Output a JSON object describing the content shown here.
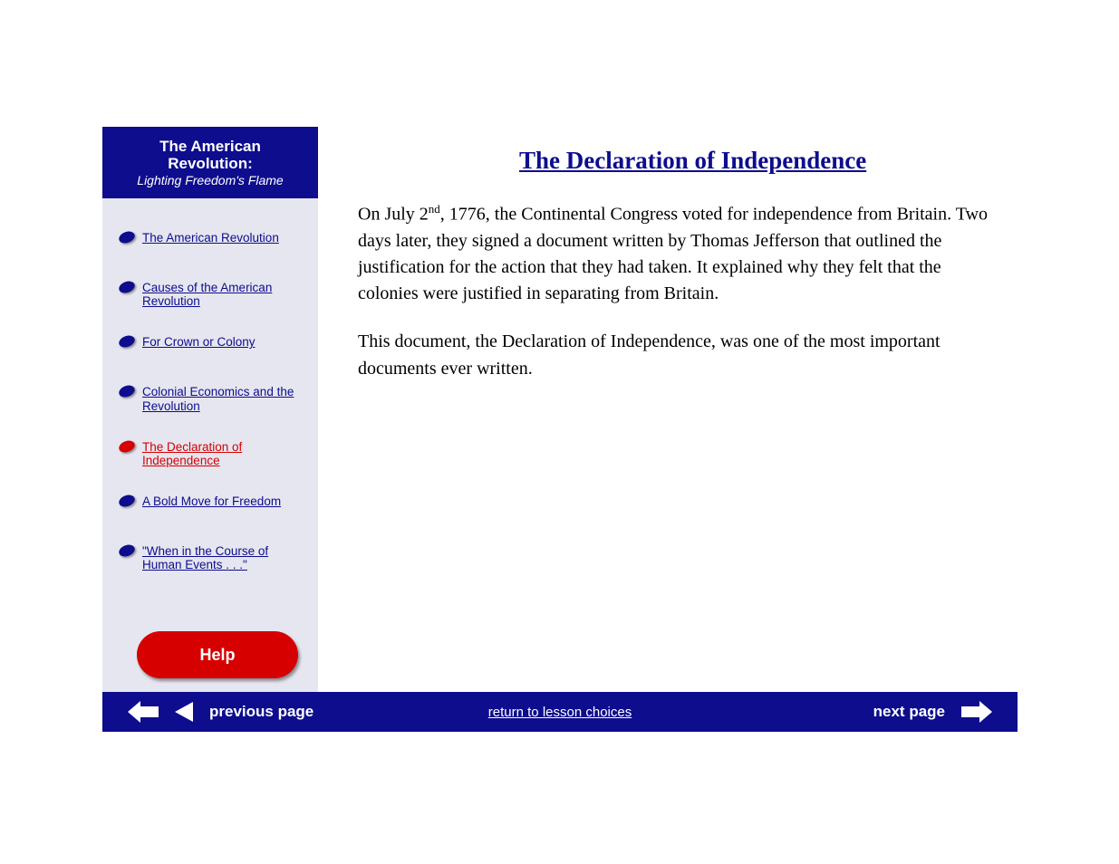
{
  "sidebar": {
    "header_line1": "The American",
    "header_line2": "Revolution:",
    "header_line3": "Lighting Freedom's Flame",
    "items": [
      {
        "label": "The American Revolution",
        "active": false
      },
      {
        "label": "Causes of the American Revolution",
        "active": false
      },
      {
        "label": "For Crown or Colony",
        "active": false
      },
      {
        "label": "Colonial Economics and the Revolution",
        "active": false
      },
      {
        "label": "The Declaration of Independence",
        "active": true
      },
      {
        "label": "A Bold Move for Freedom",
        "active": false
      },
      {
        "label": "\"When in the Course of Human Events . . .\"",
        "active": false
      }
    ],
    "help_label": "Help"
  },
  "title": "The Declaration of Independence",
  "body": {
    "p1_a": "On July 2",
    "p1_sup": "nd",
    "p1_b": ", 1776, the Continental Congress voted for independence from Britain. Two days later, they signed a document written by Thomas Jefferson that outlined the justification for the action that they had taken. It explained why they felt that the colonies were justified in separating from Britain.",
    "p2": "This document, the Declaration of Independence, was one of the most important documents ever written."
  },
  "nav": {
    "prev_page": "previous page",
    "center": "return to lesson choices",
    "next_page": "next page"
  }
}
